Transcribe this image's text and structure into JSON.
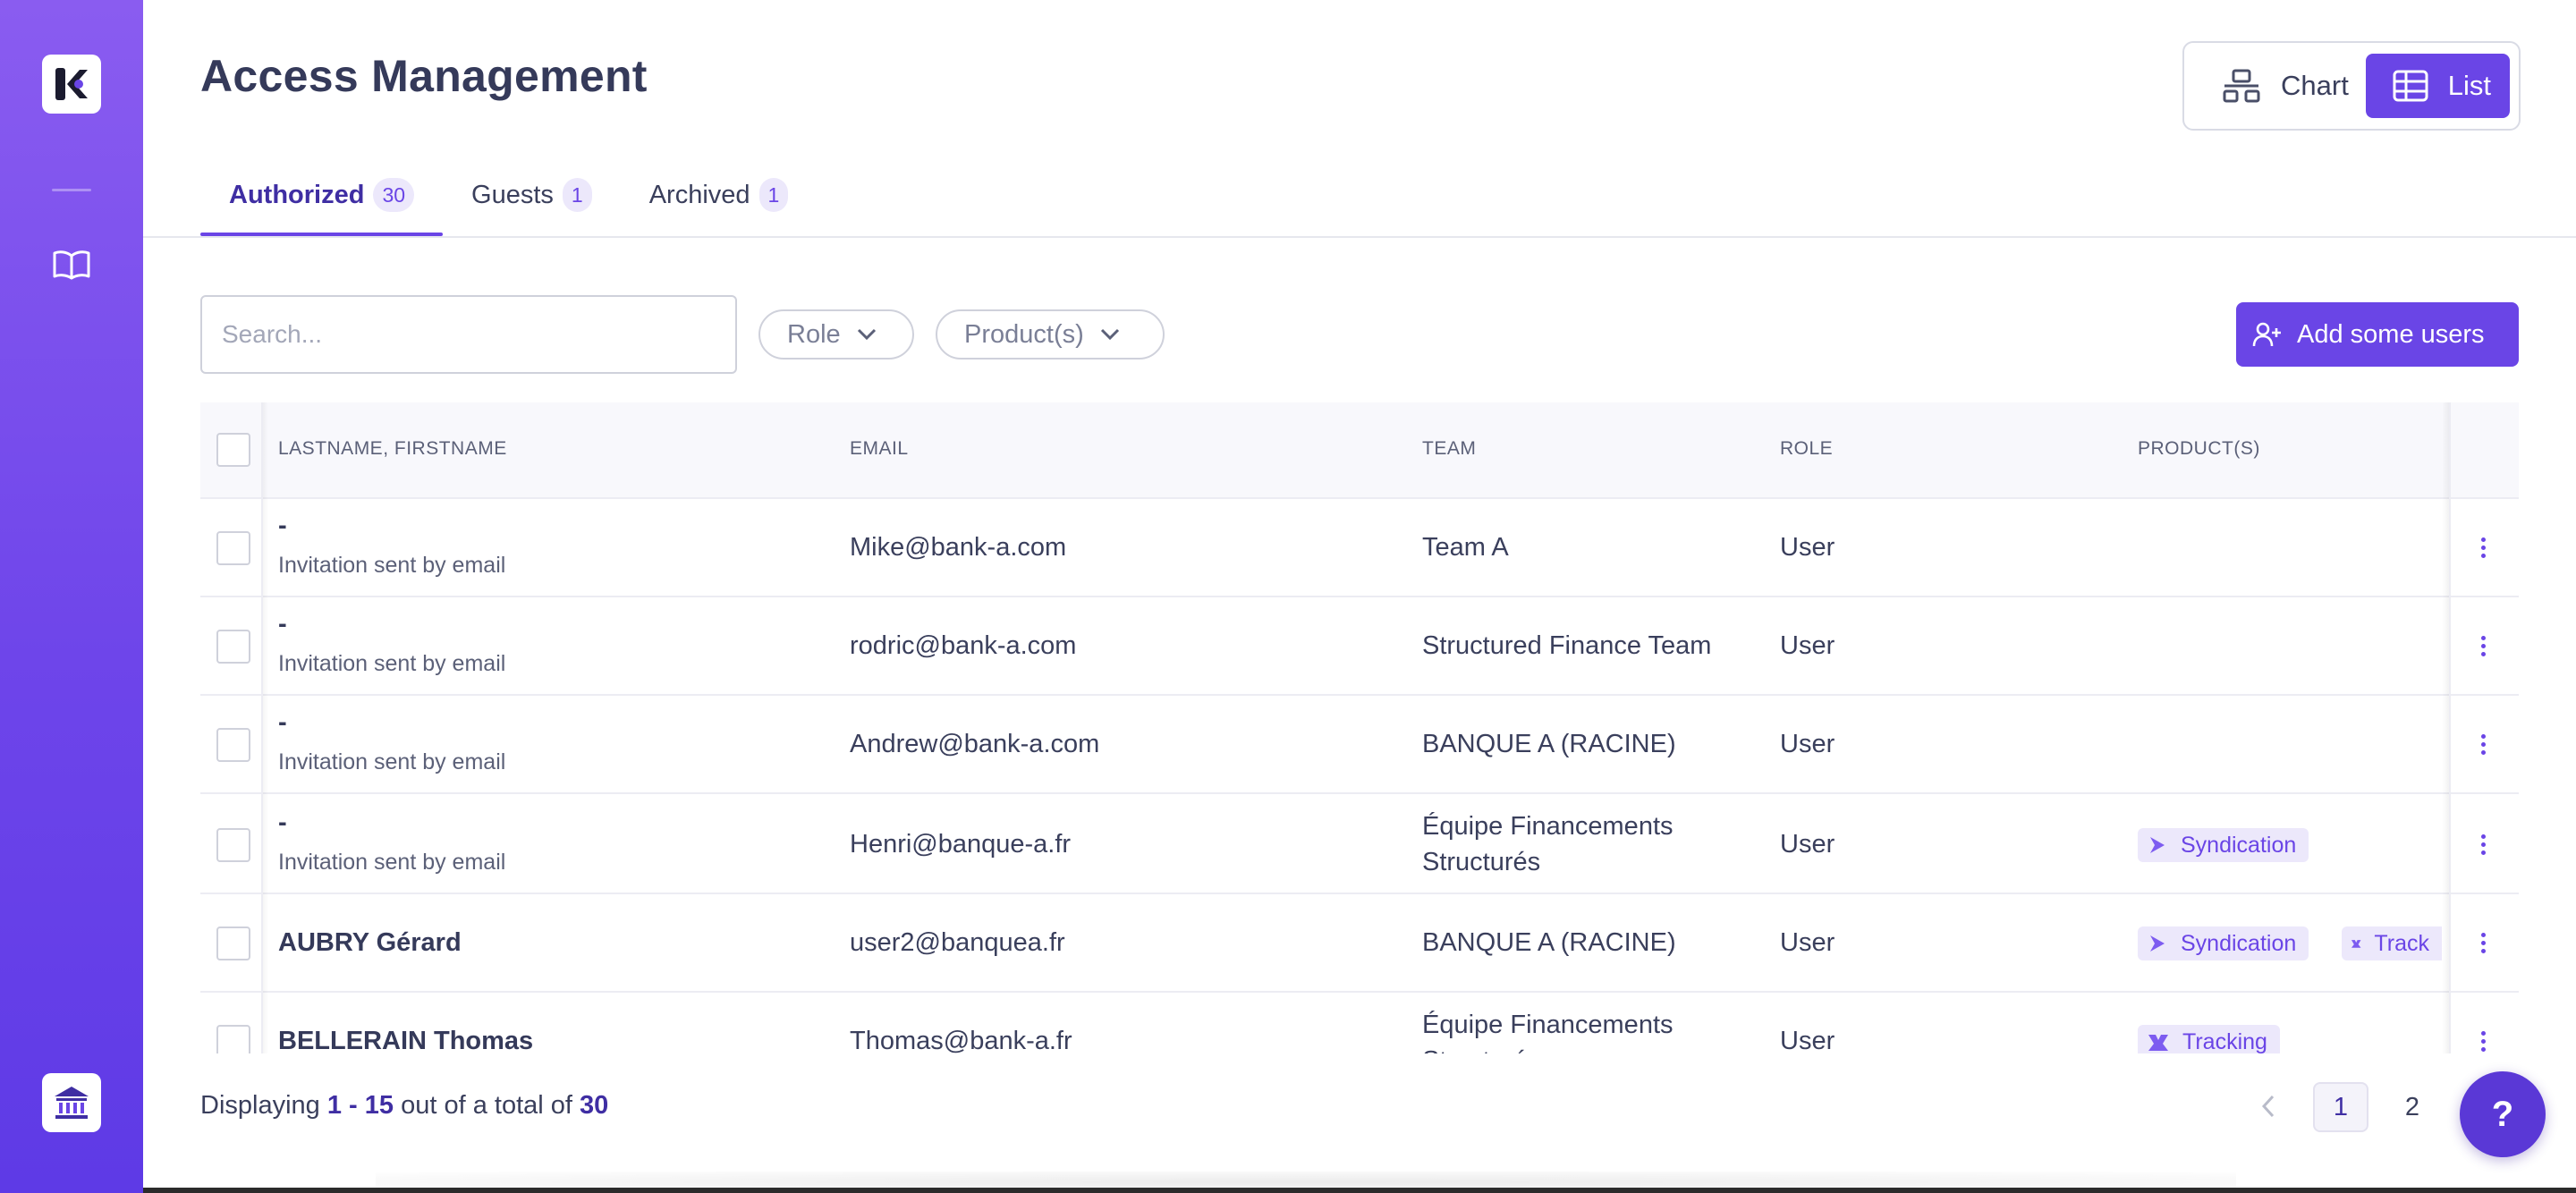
{
  "header": {
    "title": "Access Management",
    "view_toggle": {
      "chart_label": "Chart",
      "list_label": "List",
      "active": "list"
    }
  },
  "tabs": [
    {
      "label": "Authorized",
      "count": "30",
      "active": true
    },
    {
      "label": "Guests",
      "count": "1",
      "active": false
    },
    {
      "label": "Archived",
      "count": "1",
      "active": false
    }
  ],
  "filters": {
    "search_placeholder": "Search...",
    "role_label": "Role",
    "product_label": "Product(s)",
    "add_users_label": "Add some users"
  },
  "table": {
    "columns": {
      "name": "LASTNAME, FIRSTNAME",
      "email": "EMAIL",
      "team": "TEAM",
      "role": "ROLE",
      "products": "PRODUCT(S)"
    },
    "rows": [
      {
        "name": "-",
        "subtitle": "Invitation sent by email",
        "email": "Mike@bank-a.com",
        "team": "Team A",
        "team2": "",
        "role": "User",
        "products": []
      },
      {
        "name": "-",
        "subtitle": "Invitation sent by email",
        "email": "rodric@bank-a.com",
        "team": "Structured Finance Team",
        "team2": "",
        "role": "User",
        "products": []
      },
      {
        "name": "-",
        "subtitle": "Invitation sent by email",
        "email": "Andrew@bank-a.com",
        "team": "BANQUE A (RACINE)",
        "team2": "",
        "role": "User",
        "products": []
      },
      {
        "name": "-",
        "subtitle": "Invitation sent by email",
        "email": "Henri@banque-a.fr",
        "team": "Équipe Financements",
        "team2": "Structurés",
        "role": "User",
        "products": [
          "Syndication"
        ]
      },
      {
        "name": "AUBRY Gérard",
        "subtitle": "",
        "email": "user2@banquea.fr",
        "team": "BANQUE A (RACINE)",
        "team2": "",
        "role": "User",
        "products": [
          "Syndication",
          "Track"
        ]
      },
      {
        "name": "BELLERAIN Thomas",
        "subtitle": "",
        "email": "Thomas@bank-a.fr",
        "team": "Équipe Financements",
        "team2": "Structurés",
        "role": "User",
        "products": [
          "Tracking"
        ]
      }
    ]
  },
  "footer": {
    "display_prefix": "Displaying",
    "display_range": "1 - 15",
    "display_mid": "out of a total of",
    "display_total": "30",
    "pages": [
      "1",
      "2"
    ],
    "current_page": "1",
    "help_label": "?"
  },
  "colors": {
    "accent": "#6a45e6",
    "sidebar_top": "#8a5cf0",
    "sidebar_bottom": "#5e3ae6",
    "tag_bg": "#ece8fb"
  }
}
